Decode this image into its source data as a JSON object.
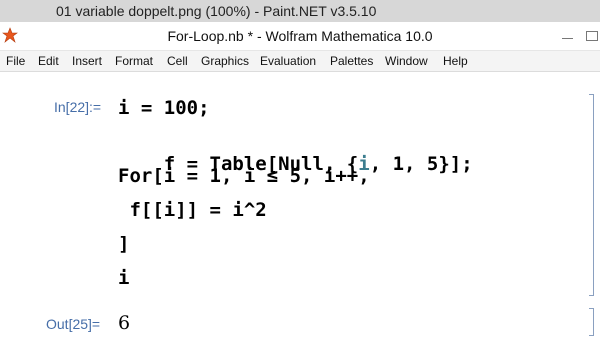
{
  "outer_window": {
    "title": "01 variable doppelt.png (100%) - Paint.NET v3.5.10"
  },
  "window": {
    "title": "For-Loop.nb * - Wolfram Mathematica 10.0"
  },
  "menu": [
    "File",
    "Edit",
    "Insert",
    "Format",
    "Cell",
    "Graphics",
    "Evaluation",
    "Palettes",
    "Window",
    "Help"
  ],
  "notebook": {
    "input_label": "In[22]:=",
    "code_lines": [
      "i = 100;",
      "f = Table[Null, {i, 1, 5}];",
      "For[i = 1, i ≤ 5, i++,",
      " f[[i]] = i^2",
      "]",
      "i"
    ],
    "output_label": "Out[25]=",
    "output_value": "6"
  },
  "colors": {
    "label": "#466ea8",
    "local_var": "#3c7d8f",
    "bracket": "#8aa0c0"
  }
}
